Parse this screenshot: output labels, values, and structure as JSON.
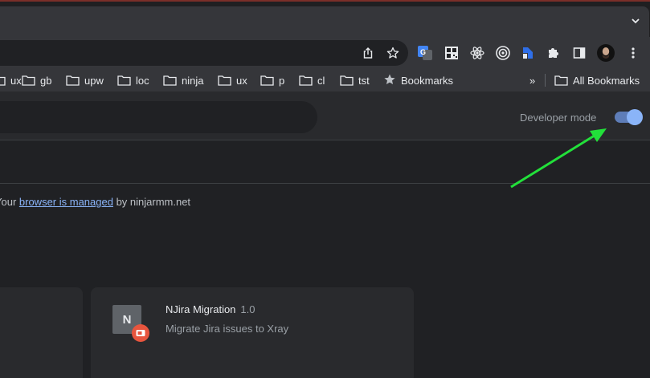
{
  "bookmarks_bar": {
    "items": [
      {
        "label": "ux",
        "type": "folder",
        "icon": "folder-icon"
      },
      {
        "label": "gb",
        "type": "folder",
        "icon": "folder-icon"
      },
      {
        "label": "upw",
        "type": "folder",
        "icon": "folder-icon"
      },
      {
        "label": "loc",
        "type": "folder",
        "icon": "folder-icon"
      },
      {
        "label": "ninja",
        "type": "folder",
        "icon": "folder-icon"
      },
      {
        "label": "ux",
        "type": "folder",
        "icon": "folder-icon"
      },
      {
        "label": "p",
        "type": "folder",
        "icon": "folder-icon"
      },
      {
        "label": "cl",
        "type": "folder",
        "icon": "folder-icon"
      },
      {
        "label": "tst",
        "type": "folder",
        "icon": "folder-icon"
      },
      {
        "label": "Bookmarks",
        "type": "link",
        "icon": "star-icon"
      }
    ],
    "overflow_label": "»",
    "all_bookmarks_label": "All Bookmarks"
  },
  "toolbar": {
    "extensions": [
      "google-translate-icon",
      "qr-code-icon",
      "react-devtools-icon",
      "target-icon",
      "ninja-extension-icon",
      "puzzle-icon",
      "side-panel-icon"
    ],
    "menu_label": "⋮"
  },
  "extensions_page": {
    "developer_mode_label": "Developer mode",
    "developer_mode_enabled": true,
    "managed_notice": {
      "prefix": "Your ",
      "link": "browser is managed",
      "suffix": " by ninjarmm.net"
    },
    "extension": {
      "icon_letter": "N",
      "name": "NJira Migration",
      "version": "1.0",
      "description": "Migrate Jira issues to Xray"
    }
  },
  "colors": {
    "accent_blue": "#8ab4f8",
    "annotation_arrow": "#22e03a",
    "badge": "#e8553e"
  }
}
